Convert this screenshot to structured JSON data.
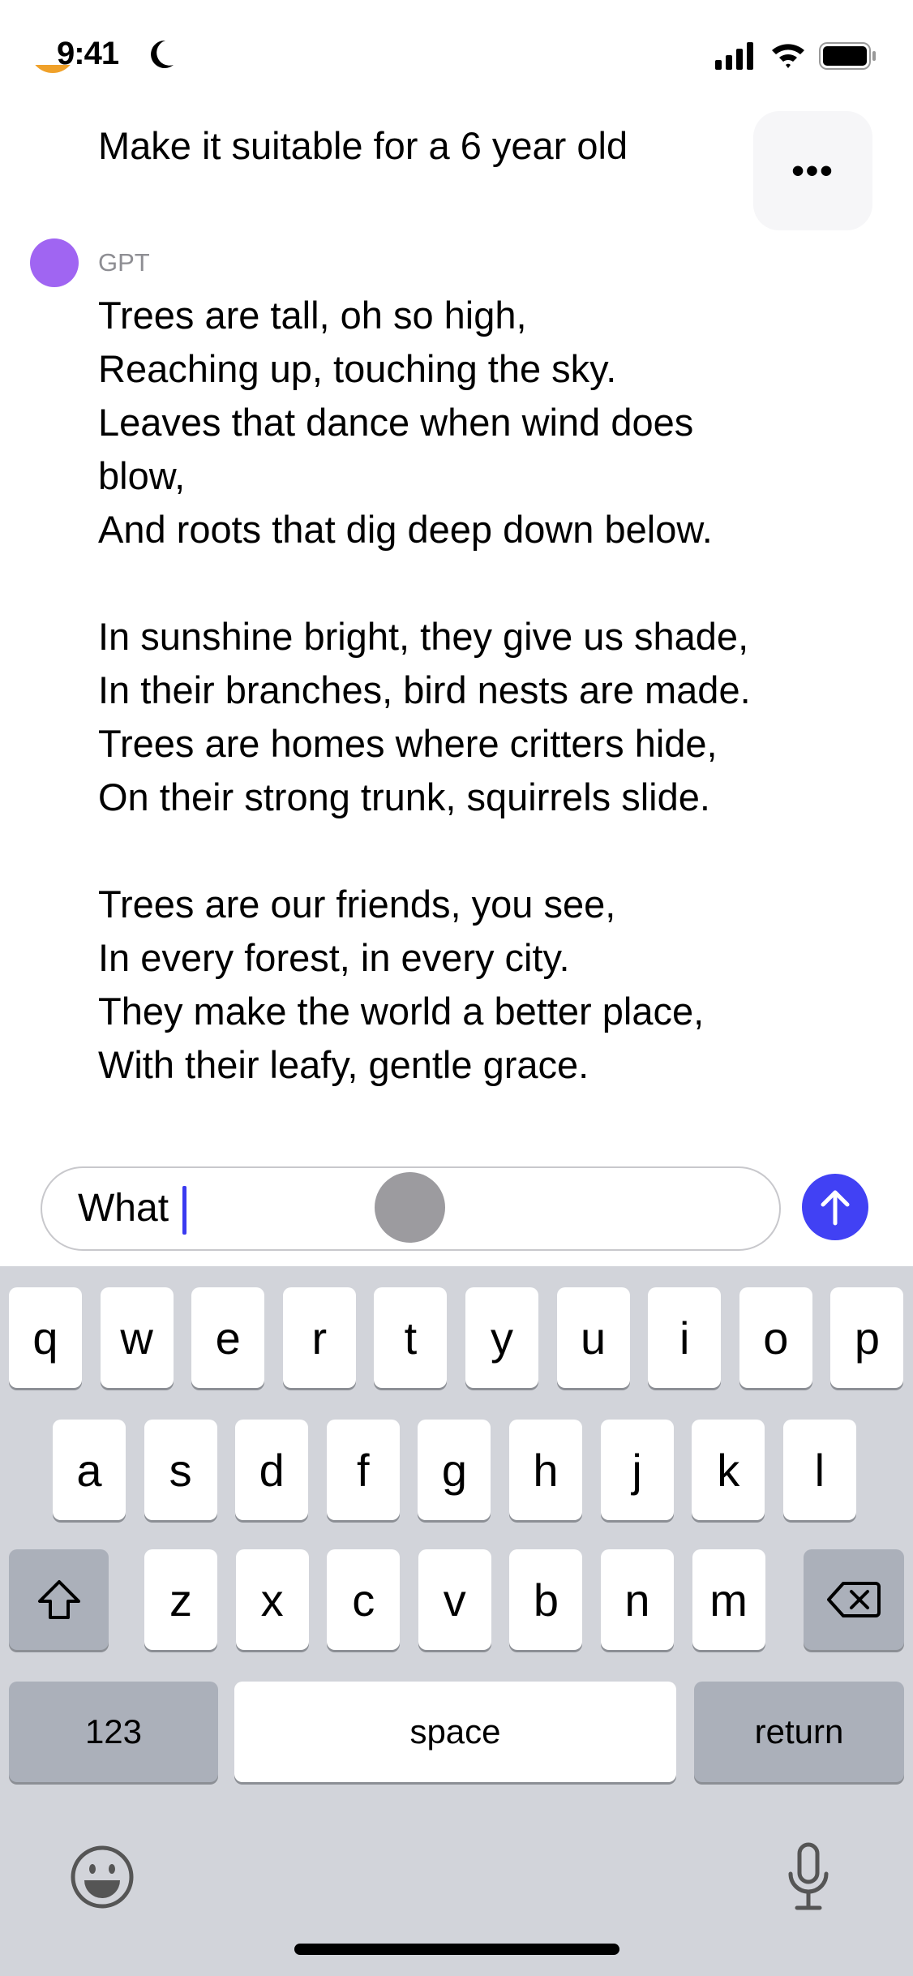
{
  "status_bar": {
    "time": "9:41",
    "focus_icon": "moon-icon",
    "signal_icon": "cellular-signal-icon",
    "wifi_icon": "wifi-icon",
    "battery_icon": "battery-icon"
  },
  "chat": {
    "user_message": "Make it suitable for a 6 year old",
    "more_label": "•••",
    "assistant_name": "GPT",
    "assistant_message": "Trees are tall, oh so high,\nReaching up, touching the sky.\nLeaves that dance when wind does\nblow,\nAnd roots that dig deep down below.\n\nIn sunshine bright, they give us shade,\nIn their branches, bird nests are made.\nTrees are homes where critters hide,\nOn their strong trunk, squirrels slide.\n\nTrees are our friends, you see,\nIn every forest, in every city.\nThey make the world a better place,\nWith their leafy, gentle grace."
  },
  "composer": {
    "value": "What",
    "send_icon": "arrow-up-icon"
  },
  "colors": {
    "accent": "#4141f4",
    "assistant_avatar": "#a065f2",
    "user_avatar": "#f0a12a"
  },
  "keyboard": {
    "row1": [
      "q",
      "w",
      "e",
      "r",
      "t",
      "y",
      "u",
      "i",
      "o",
      "p"
    ],
    "row2": [
      "a",
      "s",
      "d",
      "f",
      "g",
      "h",
      "j",
      "k",
      "l"
    ],
    "row3": [
      "z",
      "x",
      "c",
      "v",
      "b",
      "n",
      "m"
    ],
    "numbers": "123",
    "space": "space",
    "return": "return"
  }
}
